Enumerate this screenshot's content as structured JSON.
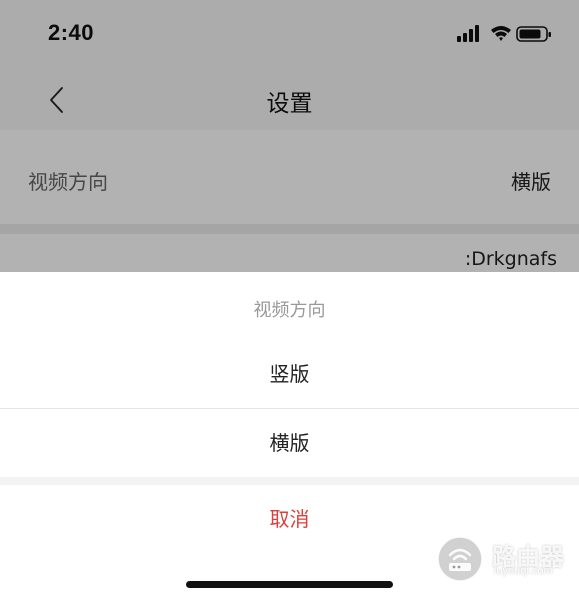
{
  "status_bar": {
    "time": "2:40",
    "icons": [
      "signal-icon",
      "wifi-icon",
      "battery-icon"
    ]
  },
  "nav": {
    "back_icon": "chevron-left-icon",
    "title": "设置"
  },
  "settings": {
    "orientation_label": "视频方向",
    "orientation_value": "横版",
    "second_row_value": ":Drkgnafs"
  },
  "action_sheet": {
    "title": "视频方向",
    "options": [
      "竖版",
      "横版"
    ],
    "cancel": "取消"
  },
  "watermark": {
    "text_cn": "路由器",
    "text_en": "luyouqi.com"
  },
  "colors": {
    "cancel": "#d9413a",
    "overlay": "rgba(0,0,0,0.30)"
  }
}
